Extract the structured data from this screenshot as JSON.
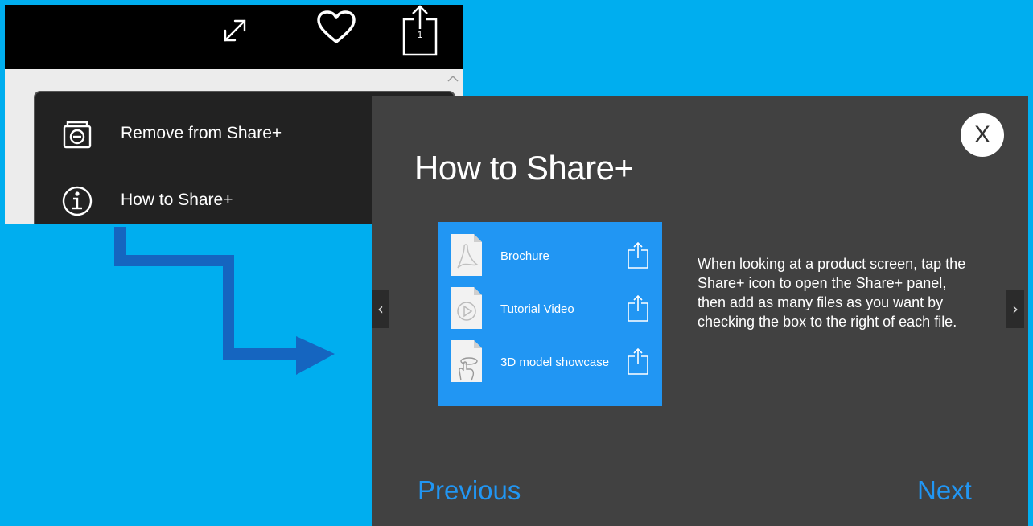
{
  "topbar": {
    "icons": [
      "expand-icon",
      "heart-icon",
      "share-count-icon"
    ],
    "share_count": "1"
  },
  "menu": {
    "items": [
      {
        "label": "Remove from Share+",
        "icon": "remove-share-icon"
      },
      {
        "label": "How to Share+",
        "icon": "info-icon"
      }
    ]
  },
  "dialog": {
    "title": "How to Share+",
    "close_label": "X",
    "files": [
      {
        "name": "Brochure",
        "icon": "pdf-doc-icon"
      },
      {
        "name": "Tutorial Video",
        "icon": "video-doc-icon"
      },
      {
        "name": "3D model showcase",
        "icon": "3d-model-doc-icon"
      }
    ],
    "description": "When looking at a product screen, tap the Share+ icon to open the Share+ panel, then add as many files as you want by checking the box to the right of each file.",
    "prev_label": "Previous",
    "next_label": "Next",
    "nav_left": "‹",
    "nav_right": "›"
  },
  "colors": {
    "background": "#00aeef",
    "dialog_bg": "#414141",
    "panel_blue": "#2196f3",
    "menu_bg": "#222222",
    "arrow_blue": "#1565c0"
  }
}
